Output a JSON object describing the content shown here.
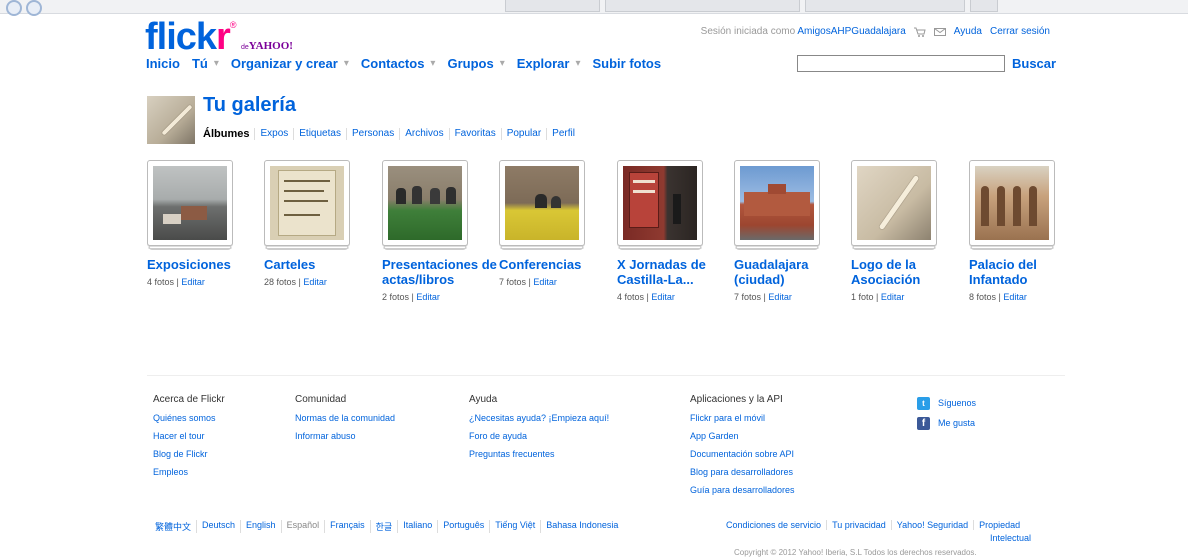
{
  "brand": {
    "logo_main": "flickr",
    "logo_de": "de",
    "logo_yahoo": "YAHOO!"
  },
  "userbar": {
    "signed_in": "Sesión iniciada como",
    "username": "AmigosAHPGuadalajara",
    "help": "Ayuda",
    "logout": "Cerrar sesión"
  },
  "nav": {
    "items": [
      {
        "label": "Inicio",
        "caret": false
      },
      {
        "label": "Tú",
        "caret": true
      },
      {
        "label": "Organizar y crear",
        "caret": true
      },
      {
        "label": "Contactos",
        "caret": true
      },
      {
        "label": "Grupos",
        "caret": true
      },
      {
        "label": "Explorar",
        "caret": true
      },
      {
        "label": "Subir fotos",
        "caret": false
      }
    ],
    "search_value": "",
    "search_button": "Buscar"
  },
  "gallery": {
    "title": "Tu galería",
    "tabs": [
      "Álbumes",
      "Expos",
      "Etiquetas",
      "Personas",
      "Archivos",
      "Favoritas",
      "Popular",
      "Perfil"
    ]
  },
  "albums": [
    {
      "name": "Exposiciones",
      "count": "4 fotos",
      "edit": "Editar"
    },
    {
      "name": "Carteles",
      "count": "28 fotos",
      "edit": "Editar"
    },
    {
      "name": "Presentaciones de actas/libros",
      "count": "2 fotos",
      "edit": "Editar"
    },
    {
      "name": "Conferencias",
      "count": "7 fotos",
      "edit": "Editar"
    },
    {
      "name": "X Jornadas de Castilla-La...",
      "count": "4 fotos",
      "edit": "Editar"
    },
    {
      "name": "Guadalajara (ciudad)",
      "count": "7 fotos",
      "edit": "Editar"
    },
    {
      "name": "Logo de la Asociación",
      "count": "1 foto",
      "edit": "Editar"
    },
    {
      "name": "Palacio del Infantado",
      "count": "8 fotos",
      "edit": "Editar"
    }
  ],
  "footer": {
    "columns": [
      {
        "heading": "Acerca de Flickr",
        "links": [
          "Quiénes somos",
          "Hacer el tour",
          "Blog de Flickr",
          "Empleos"
        ]
      },
      {
        "heading": "Comunidad",
        "links": [
          "Normas de la comunidad",
          "Informar abuso"
        ]
      },
      {
        "heading": "Ayuda",
        "links": [
          "¿Necesitas ayuda? ¡Empieza aquí!",
          "Foro de ayuda",
          "Preguntas frecuentes"
        ]
      },
      {
        "heading": "Aplicaciones y la API",
        "links": [
          "Flickr para el móvil",
          "App Garden",
          "Documentación sobre API",
          "Blog para desarrolladores",
          "Guía para desarrolladores"
        ]
      }
    ],
    "social": {
      "twitter": "Síguenos",
      "facebook": "Me gusta"
    },
    "languages": [
      "繁體中文",
      "Deutsch",
      "English",
      "Español",
      "Français",
      "한글",
      "Italiano",
      "Português",
      "Tiếng Việt",
      "Bahasa Indonesia"
    ],
    "current_language": "Español",
    "legal": [
      "Condiciones de servicio",
      "Tu privacidad",
      "Yahoo! Seguridad",
      "Propiedad"
    ],
    "legal_wrap": "Intelectual",
    "copyright": "Copyright © 2012 Yahoo! Iberia, S.L Todos los derechos reservados."
  }
}
